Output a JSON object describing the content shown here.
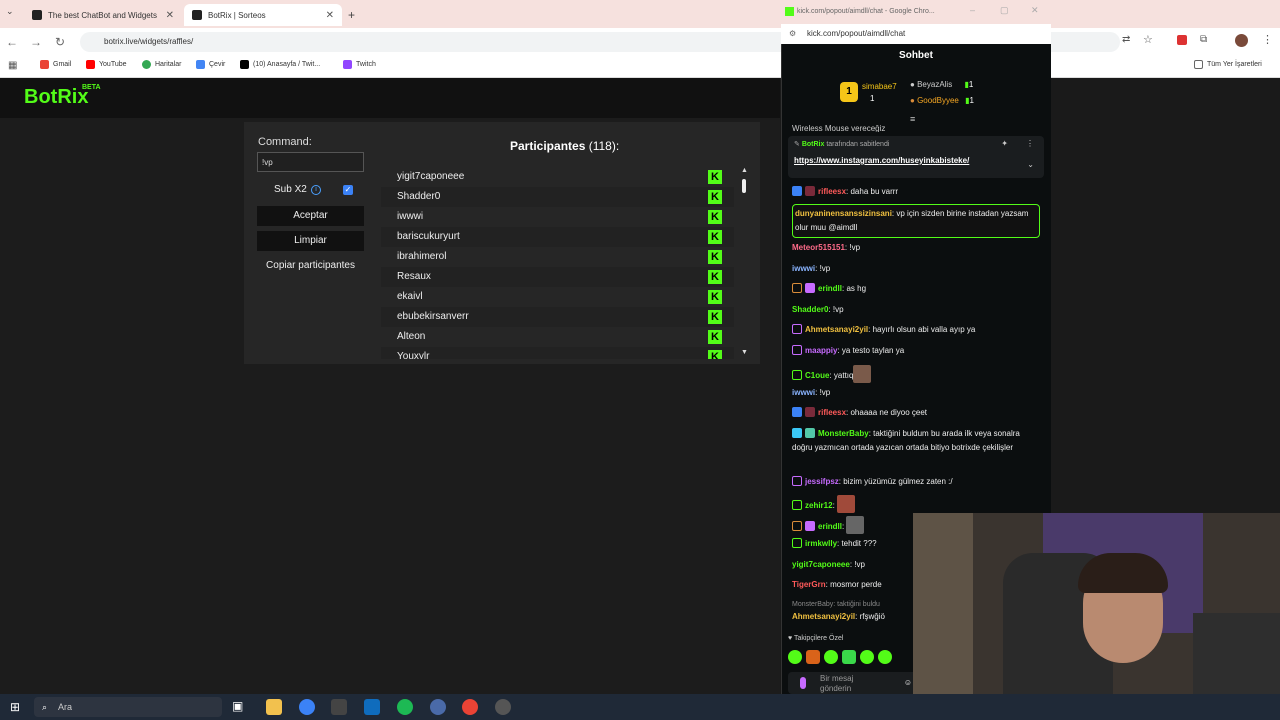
{
  "browser": {
    "tabs": [
      {
        "label": "The best ChatBot and Widgets"
      },
      {
        "label": "BotRix | Sorteos"
      }
    ],
    "url": "botrix.live/widgets/raffles/",
    "bookmarks": [
      {
        "label": "Gmail"
      },
      {
        "label": "YouTube"
      },
      {
        "label": "Haritalar"
      },
      {
        "label": "Çevir"
      },
      {
        "label": "(10) Anasayfa / Twit..."
      },
      {
        "label": "Twitch"
      }
    ],
    "all_bookmarks": "Tüm Yer İşaretleri"
  },
  "botrix": {
    "logo": "BotRix",
    "beta": "BETA",
    "command_label": "Command:",
    "command_value": "!vp",
    "sub_label": "Sub X2",
    "sub_checked": true,
    "buttons": {
      "accept": "Aceptar",
      "clear": "Limpiar",
      "copy": "Copiar participantes"
    },
    "participants_title": "Participantes",
    "participants_count": "(118):",
    "participants": [
      "yigit7caponeee",
      "Shadder0",
      "iwwwi",
      "bariscukuryurt",
      "ibrahimerol",
      "Resaux",
      "ekaivl",
      "ebubekirsanverr",
      "Alteon",
      "Youxylr"
    ]
  },
  "kick": {
    "window_title": "kick.com/popout/aimdll/chat - Google Chro...",
    "url": "kick.com/popout/aimdll/chat",
    "chat_title": "Sohbet",
    "leaderboard": [
      {
        "name": "simabae7",
        "count": "1"
      },
      {
        "name": "BeyazAlis",
        "count": "1"
      },
      {
        "name": "GoodByyee",
        "count": "1"
      }
    ],
    "cut_text": "Wireless Mouse vereceğiz",
    "pinned_by": "BotRix",
    "pinned_suffix": "tarafından sabitlendi",
    "pinned_link": "https://www.instagram.com/huseyinkabisteke/",
    "messages": [
      {
        "user": "rifleesx",
        "color": "#ff5a5a",
        "text": ": daha bu varrr"
      },
      {
        "user": "dunyaninensanssizinsani",
        "color": "#f0c040",
        "text": ": vp için sizden birine instadan yazsam olur muu @aimdll"
      },
      {
        "user": "Meteor515151",
        "color": "#ff6b8a",
        "text": ": !vp"
      },
      {
        "user": "iwwwi",
        "color": "#8ab4ff",
        "text": ": !vp"
      },
      {
        "user": "erindll",
        "color": "#53fc18",
        "text": ": as hg"
      },
      {
        "user": "Shadder0",
        "color": "#53fc18",
        "text": ": !vp"
      },
      {
        "user": "Ahmetsanayi2yil",
        "color": "#f0c040",
        "text": ": hayırlı olsun abi valla ayıp ya"
      },
      {
        "user": "maappiy",
        "color": "#c76bff",
        "text": ": ya testo taylan ya"
      },
      {
        "user": "C1oue",
        "color": "#53fc18",
        "text": ": yattıq"
      },
      {
        "user": "iwwwi",
        "color": "#8ab4ff",
        "text": ": !vp"
      },
      {
        "user": "rifleesx",
        "color": "#ff5a5a",
        "text": ": ohaaaa ne diyoo çeet"
      },
      {
        "user": "MonsterBaby",
        "color": "#53fc18",
        "text": ": taktiğini buldum bu arada ilk veya sonalra doğru yazmıcan ortada yazıcan ortada bitiyo botrixde çekilişler"
      },
      {
        "user": "jessifpsz",
        "color": "#c76bff",
        "text": ": bizim yüzümüz gülmez zaten :/"
      },
      {
        "user": "zehir12",
        "color": "#53fc18",
        "text": ":"
      },
      {
        "user": "erindll",
        "color": "#53fc18",
        "text": ":"
      },
      {
        "user": "irmkwlly",
        "color": "#53fc18",
        "text": ": tehdit ???"
      },
      {
        "user": "yigit7caponeee",
        "color": "#53fc18",
        "text": ": !vp"
      },
      {
        "user": "TigerGrn",
        "color": "#ff5a5a",
        "text": ": mosmor perde"
      }
    ],
    "reply_preview": "MonsterBaby: taktiğini buldu",
    "last_message": {
      "user": "Ahmetsanayi2yil",
      "text": ": rfşwğiö"
    },
    "followers_only": "Takipçilere Özel",
    "input_placeholder": "Bir mesaj gönderin"
  },
  "taskbar": {
    "search": "Ara"
  }
}
